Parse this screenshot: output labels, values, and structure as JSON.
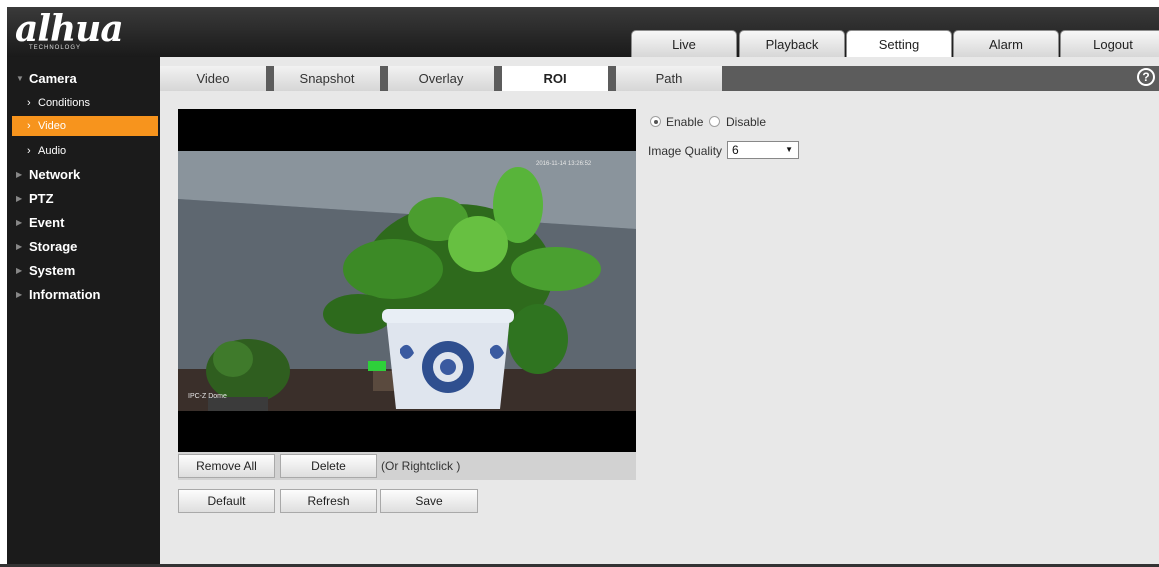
{
  "header": {
    "logo": "alhua",
    "logo_sub": "TECHNOLOGY",
    "nav": [
      {
        "label": "Live"
      },
      {
        "label": "Playback"
      },
      {
        "label": "Setting"
      },
      {
        "label": "Alarm"
      },
      {
        "label": "Logout"
      }
    ],
    "active_nav": "Setting"
  },
  "sidebar": {
    "camera": "Camera",
    "camera_sub": [
      {
        "label": "Conditions"
      },
      {
        "label": "Video"
      },
      {
        "label": "Audio"
      }
    ],
    "active_sub": "Video",
    "groups": [
      {
        "label": "Network"
      },
      {
        "label": "PTZ"
      },
      {
        "label": "Event"
      },
      {
        "label": "Storage"
      },
      {
        "label": "System"
      },
      {
        "label": "Information"
      }
    ]
  },
  "subtabs": [
    {
      "label": "Video"
    },
    {
      "label": "Snapshot"
    },
    {
      "label": "Overlay"
    },
    {
      "label": "ROI"
    },
    {
      "label": "Path"
    }
  ],
  "active_subtab": "ROI",
  "help_glyph": "?",
  "video": {
    "osd_time": "2016-11-14 13:26:52",
    "osd_name": "IPC-Z Dome"
  },
  "roi_actions": {
    "remove_all": "Remove All",
    "delete": "Delete",
    "hint": "(Or Rightclick )"
  },
  "settings": {
    "enable_label": "Enable",
    "disable_label": "Disable",
    "enabled": true,
    "image_quality_label": "Image Quality",
    "image_quality_value": "6"
  },
  "footer_buttons": {
    "default": "Default",
    "refresh": "Refresh",
    "save": "Save"
  },
  "colors": {
    "accent": "#f7941d",
    "sidebar_bg": "#1b1b1b",
    "content_bg": "#e8e8e8"
  }
}
